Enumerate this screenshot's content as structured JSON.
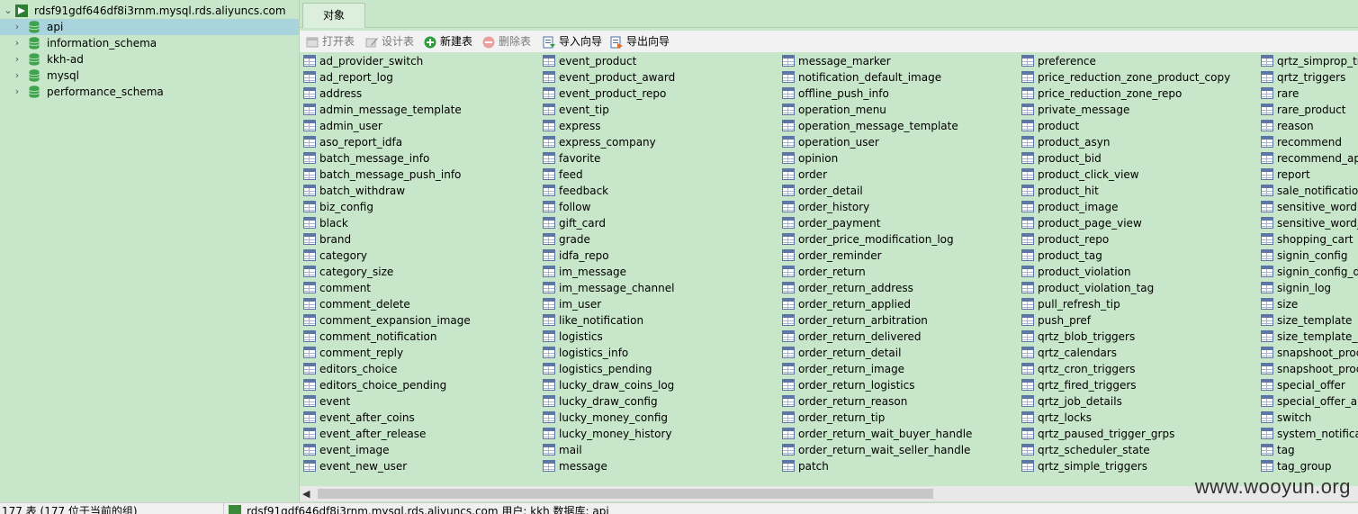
{
  "sidebar": {
    "connection": "rdsf91gdf646df8i3rnm.mysql.rds.aliyuncs.com",
    "databases": [
      {
        "name": "api",
        "selected": true
      },
      {
        "name": "information_schema",
        "selected": false
      },
      {
        "name": "kkh-ad",
        "selected": false
      },
      {
        "name": "mysql",
        "selected": false
      },
      {
        "name": "performance_schema",
        "selected": false
      }
    ]
  },
  "tabs": {
    "objects": "对象"
  },
  "toolbar": {
    "open_table": "打开表",
    "design_table": "设计表",
    "new_table": "新建表",
    "delete_table": "删除表",
    "import_wizard": "导入向导",
    "export_wizard": "导出向导"
  },
  "tables": [
    [
      "ad_provider_switch",
      "ad_report_log",
      "address",
      "admin_message_template",
      "admin_user",
      "aso_report_idfa",
      "batch_message_info",
      "batch_message_push_info",
      "batch_withdraw",
      "biz_config",
      "black",
      "brand",
      "category",
      "category_size",
      "comment",
      "comment_delete",
      "comment_expansion_image",
      "comment_notification",
      "comment_reply",
      "editors_choice",
      "editors_choice_pending",
      "event",
      "event_after_coins",
      "event_after_release",
      "event_image",
      "event_new_user"
    ],
    [
      "event_product",
      "event_product_award",
      "event_product_repo",
      "event_tip",
      "express",
      "express_company",
      "favorite",
      "feed",
      "feedback",
      "follow",
      "gift_card",
      "grade",
      "idfa_repo",
      "im_message",
      "im_message_channel",
      "im_user",
      "like_notification",
      "logistics",
      "logistics_info",
      "logistics_pending",
      "lucky_draw_coins_log",
      "lucky_draw_config",
      "lucky_money_config",
      "lucky_money_history",
      "mail",
      "message"
    ],
    [
      "message_marker",
      "notification_default_image",
      "offline_push_info",
      "operation_menu",
      "operation_message_template",
      "operation_user",
      "opinion",
      "order",
      "order_detail",
      "order_history",
      "order_payment",
      "order_price_modification_log",
      "order_reminder",
      "order_return",
      "order_return_address",
      "order_return_applied",
      "order_return_arbitration",
      "order_return_delivered",
      "order_return_detail",
      "order_return_image",
      "order_return_logistics",
      "order_return_reason",
      "order_return_tip",
      "order_return_wait_buyer_handle",
      "order_return_wait_seller_handle",
      "patch"
    ],
    [
      "preference",
      "price_reduction_zone_product_copy",
      "price_reduction_zone_repo",
      "private_message",
      "product",
      "product_asyn",
      "product_bid",
      "product_click_view",
      "product_hit",
      "product_image",
      "product_page_view",
      "product_repo",
      "product_tag",
      "product_violation",
      "product_violation_tag",
      "pull_refresh_tip",
      "push_pref",
      "qrtz_blob_triggers",
      "qrtz_calendars",
      "qrtz_cron_triggers",
      "qrtz_fired_triggers",
      "qrtz_job_details",
      "qrtz_locks",
      "qrtz_paused_trigger_grps",
      "qrtz_scheduler_state",
      "qrtz_simple_triggers"
    ],
    [
      "qrtz_simprop_tr",
      "qrtz_triggers",
      "rare",
      "rare_product",
      "reason",
      "recommend",
      "recommend_ap",
      "report",
      "sale_notification",
      "sensitive_word",
      "sensitive_word_c",
      "shopping_cart",
      "signin_config",
      "signin_config_de",
      "signin_log",
      "size",
      "size_template",
      "size_template_d",
      "snapshoot_proc",
      "snapshoot_proc",
      "special_offer",
      "special_offer_ap",
      "switch",
      "system_notificat",
      "tag",
      "tag_group"
    ]
  ],
  "watermark": "www.wooyun.org",
  "status": {
    "count": "177 表 (177 位于当前的组)",
    "connection": "rdsf91gdf646df8i3rnm.mysql.rds.aliyuncs.com    用户: kkh    数据库: api"
  },
  "colors": {
    "background": "#c8e6c9",
    "selected": "#a9d4dd",
    "toolbar": "#f2f2f2"
  }
}
